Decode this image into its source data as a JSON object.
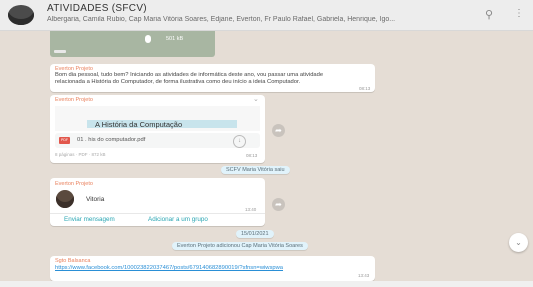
{
  "header": {
    "title": "ATIVIDADES (SFCV)",
    "participants": "Albergaria, Camila Rubio, Cap Maria Vitória Soares, Edjane, Everton, Fr Paulo Rafael, Gabriela, Henrique, Igo...",
    "search_icon": "search-icon",
    "menu_icon": "kebab-menu-icon"
  },
  "audio": {
    "size": "501 kB"
  },
  "messages": {
    "m1": {
      "sender": "Everton Projeto",
      "text": "Bom dia pessoal, tudo bem? Iniciando as atividades de informática deste ano, vou passar uma atividade relacionada a História do Computador, de forma ilustrativa como deu início a ideia Computador.",
      "time": "08:13"
    },
    "m2": {
      "sender": "Everton Projeto",
      "doc_title": "A História da Computação",
      "file_badge": "PDF",
      "file_name": "01 . his do computador.pdf",
      "meta": "8 páginas · PDF · 872 kB",
      "time": "08:13"
    },
    "m3": {
      "sender": "Everton Projeto",
      "contact_name": "Vitoria",
      "time": "13:40",
      "action_message": "Enviar mensagem",
      "action_add": "Adicionar a um grupo"
    },
    "m4": {
      "sender": "Sgto Balsanca",
      "link": "https://www.facebook.com/100023822037467/posts/679140682890019/?sfnsn=wiwspwa",
      "time": "13:43"
    }
  },
  "system": {
    "left": "SCFV Maria Vitória saiu",
    "date": "15/01/2021",
    "added": "Everton Projeto adicionou Cap Maria Vitória Soares"
  }
}
